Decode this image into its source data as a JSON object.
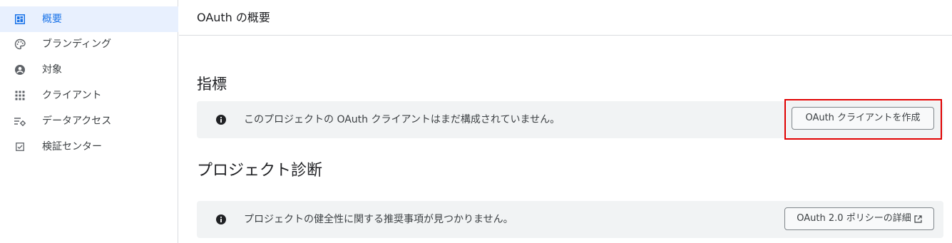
{
  "sidebar": {
    "items": [
      {
        "label": "概要",
        "icon": "dashboard-icon",
        "active": true
      },
      {
        "label": "ブランディング",
        "icon": "palette-icon",
        "active": false
      },
      {
        "label": "対象",
        "icon": "account-circle-icon",
        "active": false
      },
      {
        "label": "クライアント",
        "icon": "apps-grid-icon",
        "active": false
      },
      {
        "label": "データアクセス",
        "icon": "data-access-icon",
        "active": false
      },
      {
        "label": "検証センター",
        "icon": "check-box-icon",
        "active": false
      }
    ]
  },
  "header": {
    "title": "OAuth の概要"
  },
  "metrics": {
    "title": "指標",
    "banner_text": "このプロジェクトの OAuth クライアントはまだ構成されていません。",
    "banner_icon": "info-icon",
    "button_label": "OAuth クライアントを作成"
  },
  "diagnostics": {
    "title": "プロジェクト診断",
    "banner_text": "プロジェクトの健全性に関する推奨事項が見つかりません。",
    "banner_icon": "info-icon",
    "button_label": "OAuth 2.0 ポリシーの詳細",
    "button_icon": "open-in-new-icon"
  },
  "colors": {
    "accent": "#1a73e8",
    "active_bg": "#e8f0fe",
    "banner_bg": "#f1f3f4",
    "highlight": "#e00000"
  }
}
